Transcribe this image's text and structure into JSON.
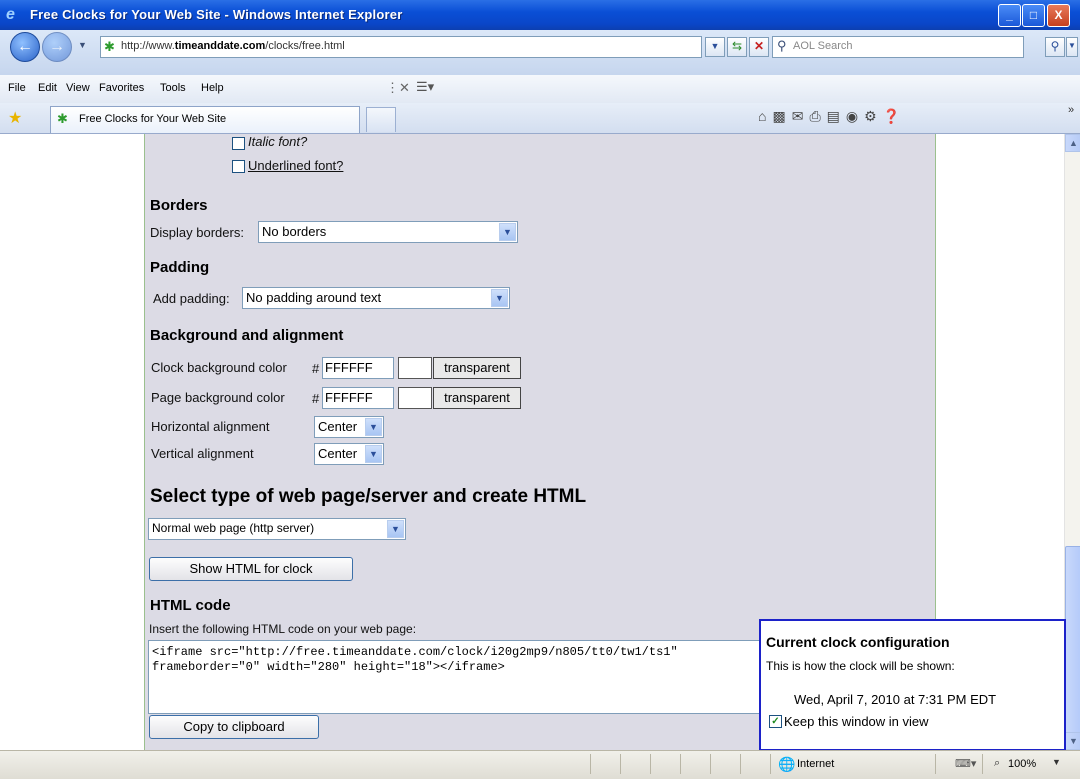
{
  "window": {
    "title": "Free Clocks for Your Web Site - Windows Internet Explorer",
    "minimize": "_",
    "maximize": "□",
    "close": "X"
  },
  "address_bar": {
    "url_prefix": "http://www.",
    "url_domain": "timeanddate.com",
    "url_path": "/clocks/free.html",
    "search_placeholder": "AOL Search"
  },
  "menu": [
    "File",
    "Edit",
    "View",
    "Favorites",
    "Tools",
    "Help"
  ],
  "tabs": [
    {
      "label": "Free Clocks for Your Web Site",
      "active": true
    }
  ],
  "form": {
    "italic_label": "Italic font?",
    "underlined_label": "Underlined font?",
    "borders": {
      "heading": "Borders",
      "label": "Display borders:",
      "value": "No borders"
    },
    "padding": {
      "heading": "Padding",
      "label": "Add padding:",
      "value": "No padding around text"
    },
    "background": {
      "heading": "Background and alignment",
      "clock_bg_label": "Clock background color",
      "clock_bg_hash": "#",
      "clock_bg_value": "FFFFFF",
      "page_bg_label": "Page background color",
      "page_bg_hash": "#",
      "page_bg_value": "FFFFFF",
      "transparent_label": "transparent",
      "h_align_label": "Horizontal alignment",
      "h_align_value": "Center",
      "v_align_label": "Vertical alignment",
      "v_align_value": "Center"
    },
    "server": {
      "heading": "Select type of web page/server and create HTML",
      "value": "Normal web page (http server)"
    },
    "show_html_button": "Show HTML for clock",
    "html_code": {
      "heading": "HTML code",
      "instruction": "Insert the following HTML code on your web page:",
      "code_line1": "<iframe src=\"http://free.timeanddate.com/clock/i20g2mp9/n805/tt0/tw1/ts1\"",
      "code_line2": "frameborder=\"0\" width=\"280\" height=\"18\"></iframe>"
    },
    "copy_button": "Copy to clipboard"
  },
  "floating_panel": {
    "title": "Current clock configuration",
    "subtitle": "This is how the clock will be shown:",
    "clock_text": "Wed, April 7, 2010 at 7:31 PM EDT",
    "keep_in_view_label": "Keep this window in view",
    "keep_in_view_checked": true
  },
  "status_bar": {
    "zone": "Internet",
    "zoom": "100%"
  },
  "colors": {
    "titlebar": "#0a4fd6",
    "panel_bg": "#dcdbe5",
    "floating_border": "#1c22c9",
    "link": "#1b3c8a"
  }
}
